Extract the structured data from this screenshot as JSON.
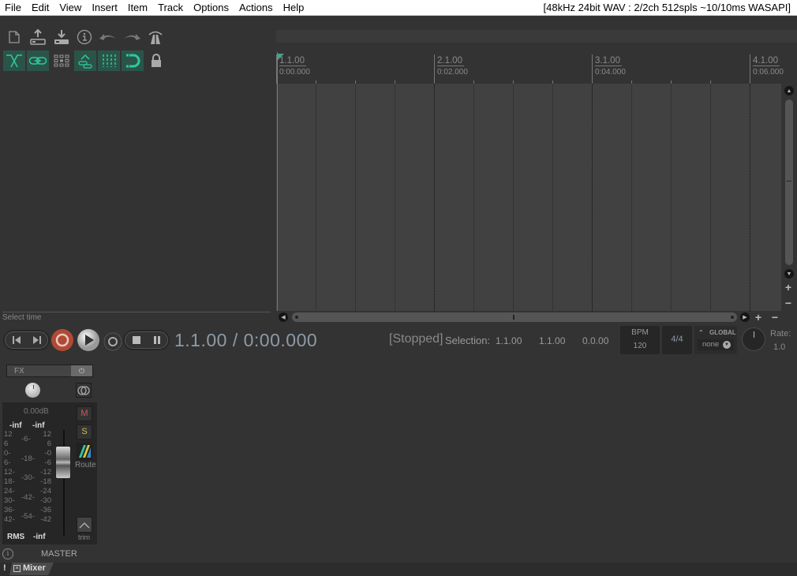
{
  "menu": {
    "items": [
      "File",
      "Edit",
      "View",
      "Insert",
      "Item",
      "Track",
      "Options",
      "Actions",
      "Help"
    ],
    "audio_status": "[48kHz 24bit WAV : 2/2ch 512spls ~10/10ms WASAPI]"
  },
  "toolbar": {
    "row1": [
      {
        "icon": "new-project-icon"
      },
      {
        "icon": "open-project-icon"
      },
      {
        "icon": "save-project-icon"
      },
      {
        "icon": "project-info-icon"
      },
      {
        "icon": "undo-icon"
      },
      {
        "icon": "redo-icon"
      },
      {
        "icon": "metronome-icon"
      }
    ],
    "row2": [
      {
        "icon": "auto-crossfade-icon",
        "active": true
      },
      {
        "icon": "ripple-link-icon",
        "active": true
      },
      {
        "icon": "grid-icon",
        "active": false
      },
      {
        "icon": "item-grouping-icon",
        "active": true
      },
      {
        "icon": "snap-lines-icon",
        "active": true
      },
      {
        "icon": "snap-magnet-icon",
        "active": true
      },
      {
        "icon": "lock-icon",
        "active": false
      }
    ]
  },
  "timeline": {
    "markers": [
      {
        "beat": "1.1.00",
        "time": "0:00.000"
      },
      {
        "beat": "2.1.00",
        "time": "0:02.000"
      },
      {
        "beat": "3.1.00",
        "time": "0:04.000"
      },
      {
        "beat": "4.1.00",
        "time": "0:06.000"
      }
    ]
  },
  "status_hint": "Select time",
  "transport": {
    "position": "1.1.00 / 0:00.000",
    "state": "[Stopped]",
    "selection_label": "Selection:",
    "selection_start": "1.1.00",
    "selection_end": "1.1.00",
    "selection_length": "0.0.00",
    "bpm_label": "BPM",
    "bpm": "120",
    "time_signature": "4/4",
    "global_label": "GLOBAL",
    "global_value": "none",
    "rate_label": "Rate:",
    "rate": "1.0"
  },
  "mixer": {
    "fx_label": "FX",
    "fx_power": "⏻",
    "volume_db": "0.00dB",
    "peak_left": "-inf",
    "peak_right": "-inf",
    "mute_label": "M",
    "solo_label": "S",
    "route_label": "Route",
    "trim_label": "trim",
    "rms_label": "RMS",
    "rms_value": "-inf",
    "scale_left": [
      "12",
      "6",
      "0-",
      "6-",
      "12-",
      "18-",
      "24-",
      "30-",
      "36-",
      "42-"
    ],
    "scale_mid": [
      "-6-",
      "-18-",
      "-30-",
      "-42-",
      "-54-"
    ],
    "scale_right": [
      "12",
      "6",
      "-0",
      "-6",
      "-12",
      "-18",
      "-24",
      "-30",
      "-36",
      "-42"
    ],
    "track_name": "MASTER"
  },
  "bottom": {
    "warning": "!",
    "mixer_tab": "Mixer"
  },
  "colors": {
    "accent": "#2e9a84",
    "active_button_bg": "#2b5448",
    "record": "#b04a35",
    "mute": "#d05a5a",
    "solo": "#d0c050"
  }
}
